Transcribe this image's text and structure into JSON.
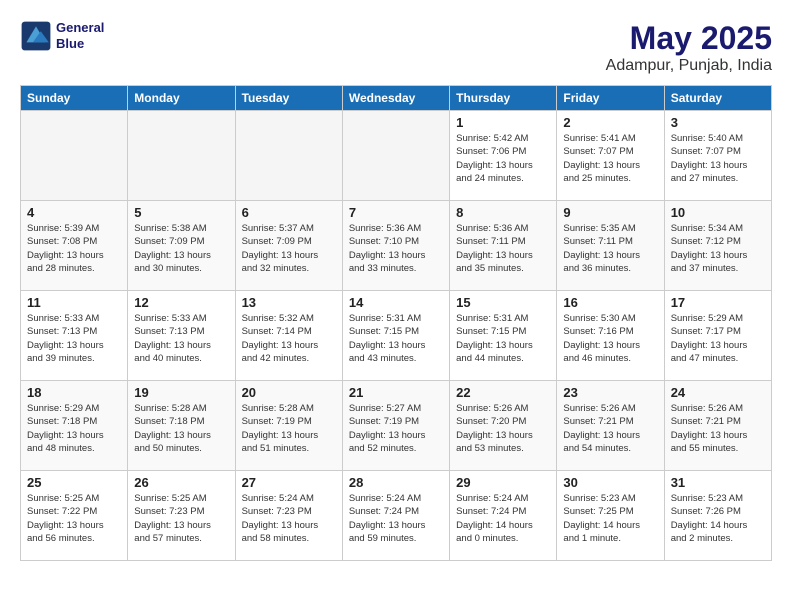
{
  "header": {
    "logo_line1": "General",
    "logo_line2": "Blue",
    "title": "May 2025",
    "subtitle": "Adampur, Punjab, India"
  },
  "weekdays": [
    "Sunday",
    "Monday",
    "Tuesday",
    "Wednesday",
    "Thursday",
    "Friday",
    "Saturday"
  ],
  "weeks": [
    [
      {
        "day": "",
        "info": ""
      },
      {
        "day": "",
        "info": ""
      },
      {
        "day": "",
        "info": ""
      },
      {
        "day": "",
        "info": ""
      },
      {
        "day": "1",
        "info": "Sunrise: 5:42 AM\nSunset: 7:06 PM\nDaylight: 13 hours\nand 24 minutes."
      },
      {
        "day": "2",
        "info": "Sunrise: 5:41 AM\nSunset: 7:07 PM\nDaylight: 13 hours\nand 25 minutes."
      },
      {
        "day": "3",
        "info": "Sunrise: 5:40 AM\nSunset: 7:07 PM\nDaylight: 13 hours\nand 27 minutes."
      }
    ],
    [
      {
        "day": "4",
        "info": "Sunrise: 5:39 AM\nSunset: 7:08 PM\nDaylight: 13 hours\nand 28 minutes."
      },
      {
        "day": "5",
        "info": "Sunrise: 5:38 AM\nSunset: 7:09 PM\nDaylight: 13 hours\nand 30 minutes."
      },
      {
        "day": "6",
        "info": "Sunrise: 5:37 AM\nSunset: 7:09 PM\nDaylight: 13 hours\nand 32 minutes."
      },
      {
        "day": "7",
        "info": "Sunrise: 5:36 AM\nSunset: 7:10 PM\nDaylight: 13 hours\nand 33 minutes."
      },
      {
        "day": "8",
        "info": "Sunrise: 5:36 AM\nSunset: 7:11 PM\nDaylight: 13 hours\nand 35 minutes."
      },
      {
        "day": "9",
        "info": "Sunrise: 5:35 AM\nSunset: 7:11 PM\nDaylight: 13 hours\nand 36 minutes."
      },
      {
        "day": "10",
        "info": "Sunrise: 5:34 AM\nSunset: 7:12 PM\nDaylight: 13 hours\nand 37 minutes."
      }
    ],
    [
      {
        "day": "11",
        "info": "Sunrise: 5:33 AM\nSunset: 7:13 PM\nDaylight: 13 hours\nand 39 minutes."
      },
      {
        "day": "12",
        "info": "Sunrise: 5:33 AM\nSunset: 7:13 PM\nDaylight: 13 hours\nand 40 minutes."
      },
      {
        "day": "13",
        "info": "Sunrise: 5:32 AM\nSunset: 7:14 PM\nDaylight: 13 hours\nand 42 minutes."
      },
      {
        "day": "14",
        "info": "Sunrise: 5:31 AM\nSunset: 7:15 PM\nDaylight: 13 hours\nand 43 minutes."
      },
      {
        "day": "15",
        "info": "Sunrise: 5:31 AM\nSunset: 7:15 PM\nDaylight: 13 hours\nand 44 minutes."
      },
      {
        "day": "16",
        "info": "Sunrise: 5:30 AM\nSunset: 7:16 PM\nDaylight: 13 hours\nand 46 minutes."
      },
      {
        "day": "17",
        "info": "Sunrise: 5:29 AM\nSunset: 7:17 PM\nDaylight: 13 hours\nand 47 minutes."
      }
    ],
    [
      {
        "day": "18",
        "info": "Sunrise: 5:29 AM\nSunset: 7:18 PM\nDaylight: 13 hours\nand 48 minutes."
      },
      {
        "day": "19",
        "info": "Sunrise: 5:28 AM\nSunset: 7:18 PM\nDaylight: 13 hours\nand 50 minutes."
      },
      {
        "day": "20",
        "info": "Sunrise: 5:28 AM\nSunset: 7:19 PM\nDaylight: 13 hours\nand 51 minutes."
      },
      {
        "day": "21",
        "info": "Sunrise: 5:27 AM\nSunset: 7:19 PM\nDaylight: 13 hours\nand 52 minutes."
      },
      {
        "day": "22",
        "info": "Sunrise: 5:26 AM\nSunset: 7:20 PM\nDaylight: 13 hours\nand 53 minutes."
      },
      {
        "day": "23",
        "info": "Sunrise: 5:26 AM\nSunset: 7:21 PM\nDaylight: 13 hours\nand 54 minutes."
      },
      {
        "day": "24",
        "info": "Sunrise: 5:26 AM\nSunset: 7:21 PM\nDaylight: 13 hours\nand 55 minutes."
      }
    ],
    [
      {
        "day": "25",
        "info": "Sunrise: 5:25 AM\nSunset: 7:22 PM\nDaylight: 13 hours\nand 56 minutes."
      },
      {
        "day": "26",
        "info": "Sunrise: 5:25 AM\nSunset: 7:23 PM\nDaylight: 13 hours\nand 57 minutes."
      },
      {
        "day": "27",
        "info": "Sunrise: 5:24 AM\nSunset: 7:23 PM\nDaylight: 13 hours\nand 58 minutes."
      },
      {
        "day": "28",
        "info": "Sunrise: 5:24 AM\nSunset: 7:24 PM\nDaylight: 13 hours\nand 59 minutes."
      },
      {
        "day": "29",
        "info": "Sunrise: 5:24 AM\nSunset: 7:24 PM\nDaylight: 14 hours\nand 0 minutes."
      },
      {
        "day": "30",
        "info": "Sunrise: 5:23 AM\nSunset: 7:25 PM\nDaylight: 14 hours\nand 1 minute."
      },
      {
        "day": "31",
        "info": "Sunrise: 5:23 AM\nSunset: 7:26 PM\nDaylight: 14 hours\nand 2 minutes."
      }
    ]
  ]
}
